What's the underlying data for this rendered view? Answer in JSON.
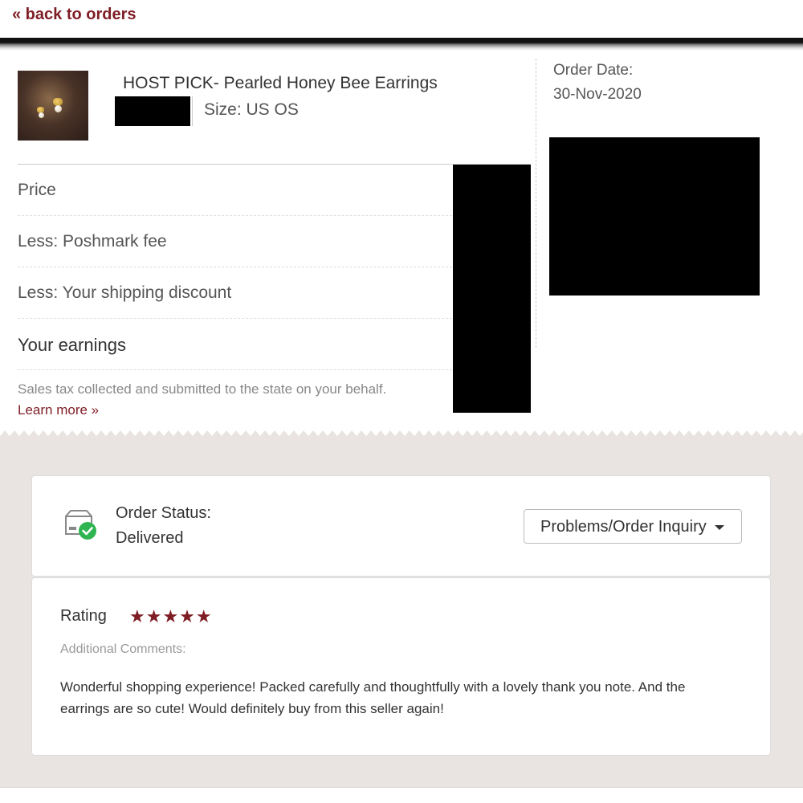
{
  "nav": {
    "back_label": "« back to orders"
  },
  "item": {
    "title": "HOST PICK- Pearled Honey Bee Earrings",
    "size": "Size: US OS",
    "image_icon": "earrings-thumbnail"
  },
  "order": {
    "date_label": "Order Date:",
    "date_value": "30-Nov-2020"
  },
  "ledger": {
    "rows": [
      {
        "label": "Price"
      },
      {
        "label": "Less: Poshmark fee"
      },
      {
        "label": "Less: Your shipping discount"
      },
      {
        "label": "Your earnings"
      }
    ],
    "tax_note": "Sales tax collected and submitted to the state on your behalf.",
    "learn_more": "Learn more »"
  },
  "status": {
    "icon": "delivered-box-icon",
    "label": "Order Status:",
    "value": "Delivered",
    "inquiry_button": "Problems/Order Inquiry"
  },
  "review": {
    "rating_label": "Rating",
    "rating_value": 5,
    "rating_max": 5,
    "stars": "★★★★★",
    "comments_label": "Additional Comments:",
    "comment": "Wonderful shopping experience! Packed carefully and thoughtfully with a lovely thank you note. And the earrings are so cute! Would definitely buy from this seller again!"
  },
  "colors": {
    "accent": "#7f1d25",
    "success": "#2eb451",
    "background_gray": "#e9e4e1"
  }
}
